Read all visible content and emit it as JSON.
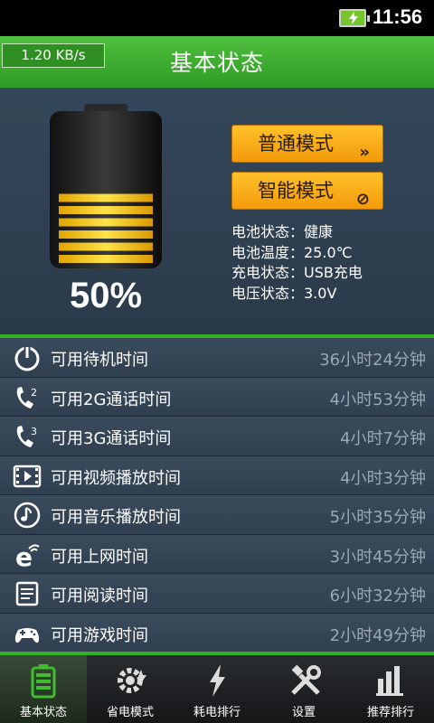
{
  "status_bar": {
    "time": "11:56"
  },
  "header": {
    "speed": "1.20 KB/s",
    "title": "基本状态"
  },
  "battery": {
    "percent_label": "50%",
    "level": 0.5
  },
  "modes": [
    {
      "label": "普通模式",
      "icon": "double-chevron-right-icon",
      "glyph": "»"
    },
    {
      "label": "智能模式",
      "icon": "prohibited-icon",
      "glyph": "⊘"
    }
  ],
  "info": [
    "电池状态：健康",
    "电池温度：25.0℃",
    "充电状态：USB充电",
    "电压状态：3.0V"
  ],
  "list": [
    {
      "label": "可用待机时间",
      "value": "36小时24分钟",
      "icon": "power-icon"
    },
    {
      "label": "可用2G通话时间",
      "value": "4小时53分钟",
      "icon": "call-2g-icon",
      "badge": "2"
    },
    {
      "label": "可用3G通话时间",
      "value": "4小时7分钟",
      "icon": "call-3g-icon",
      "badge": "3"
    },
    {
      "label": "可用视频播放时间",
      "value": "4小时3分钟",
      "icon": "video-icon"
    },
    {
      "label": "可用音乐播放时间",
      "value": "5小时35分钟",
      "icon": "music-icon"
    },
    {
      "label": "可用上网时间",
      "value": "3小时45分钟",
      "icon": "browser-icon"
    },
    {
      "label": "可用阅读时间",
      "value": "6小时32分钟",
      "icon": "book-icon"
    },
    {
      "label": "可用游戏时间",
      "value": "2小时49分钟",
      "icon": "gamepad-icon"
    }
  ],
  "nav": [
    {
      "label": "基本状态",
      "icon": "battery-icon",
      "active": true
    },
    {
      "label": "省电模式",
      "icon": "gear-icon"
    },
    {
      "label": "耗电排行",
      "icon": "lightning-icon"
    },
    {
      "label": "设置",
      "icon": "tools-icon"
    },
    {
      "label": "推荐排行",
      "icon": "bar-chart-icon"
    }
  ],
  "colors": {
    "accent_green": "#33b024",
    "button_orange": "#f39a0b",
    "panel": "#2f3f50"
  }
}
